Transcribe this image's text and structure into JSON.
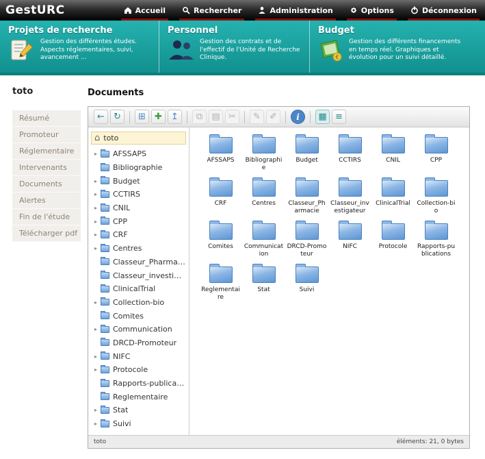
{
  "app": {
    "logo": "GestURC"
  },
  "nav": {
    "items": [
      {
        "icon": "home",
        "label": "Accueil"
      },
      {
        "icon": "search",
        "label": "Rechercher"
      },
      {
        "icon": "user",
        "label": "Administration"
      },
      {
        "icon": "gear",
        "label": "Options"
      },
      {
        "icon": "power",
        "label": "Déconnexion"
      }
    ]
  },
  "banner": {
    "sections": [
      {
        "icon": "projects",
        "title": "Projets de recherche",
        "desc": "Gestion des différentes études. Aspects réglementaires, suivi, avancement ..."
      },
      {
        "icon": "personnel",
        "title": "Personnel",
        "desc": "Gestion des contrats et de l'effectif de l'Unité de Recherche Clinique."
      },
      {
        "icon": "budget",
        "title": "Budget",
        "desc": "Gestion des différents financements en temps réel. Graphiques et évolution pour un suivi détaillé."
      }
    ]
  },
  "sidebar": {
    "title": "toto",
    "items": [
      "Résumé",
      "Promoteur",
      "Réglementaire",
      "Intervenants",
      "Documents",
      "Alertes",
      "Fin de l'étude",
      "Télécharger pdf"
    ]
  },
  "main": {
    "title": "Documents"
  },
  "fm": {
    "toolbar": [
      {
        "name": "back",
        "enabled": true
      },
      {
        "name": "reload",
        "enabled": true
      },
      {
        "name": "sep"
      },
      {
        "name": "new-folder",
        "enabled": true
      },
      {
        "name": "new-file",
        "enabled": true
      },
      {
        "name": "upload",
        "enabled": true
      },
      {
        "name": "sep"
      },
      {
        "name": "copy",
        "enabled": false
      },
      {
        "name": "paste",
        "enabled": false
      },
      {
        "name": "cut",
        "enabled": false
      },
      {
        "name": "sep"
      },
      {
        "name": "rename",
        "enabled": false
      },
      {
        "name": "edit",
        "enabled": false
      },
      {
        "name": "sep"
      },
      {
        "name": "info",
        "enabled": true
      },
      {
        "name": "sep"
      },
      {
        "name": "view-icons",
        "enabled": true,
        "active": true
      },
      {
        "name": "view-list",
        "enabled": true
      }
    ],
    "tree": {
      "root": "toto",
      "items": [
        {
          "name": "AFSSAPS",
          "expandable": true
        },
        {
          "name": "Bibliographie",
          "expandable": false
        },
        {
          "name": "Budget",
          "expandable": true
        },
        {
          "name": "CCTIRS",
          "expandable": true
        },
        {
          "name": "CNIL",
          "expandable": true
        },
        {
          "name": "CPP",
          "expandable": true
        },
        {
          "name": "CRF",
          "expandable": true
        },
        {
          "name": "Centres",
          "expandable": true
        },
        {
          "name": "Classeur_Pharmacie",
          "expandable": false
        },
        {
          "name": "Classeur_investigateur",
          "expandable": false
        },
        {
          "name": "ClinicalTrial",
          "expandable": false
        },
        {
          "name": "Collection-bio",
          "expandable": true
        },
        {
          "name": "Comites",
          "expandable": false
        },
        {
          "name": "Communication",
          "expandable": true
        },
        {
          "name": "DRCD-Promoteur",
          "expandable": false
        },
        {
          "name": "NIFC",
          "expandable": true
        },
        {
          "name": "Protocole",
          "expandable": true
        },
        {
          "name": "Rapports-publications",
          "expandable": false
        },
        {
          "name": "Reglementaire",
          "expandable": false
        },
        {
          "name": "Stat",
          "expandable": true
        },
        {
          "name": "Suivi",
          "expandable": true
        }
      ]
    },
    "grid": [
      "AFSSAPS",
      "Bibliographie",
      "Budget",
      "CCTIRS",
      "CNIL",
      "CPP",
      "CRF",
      "Centres",
      "Classeur_Pharmacie",
      "Classeur_investigateur",
      "ClinicalTrial",
      "Collection-bio",
      "Comites",
      "Communication",
      "DRCD-Promoteur",
      "NIFC",
      "Protocole",
      "Rapports-publications",
      "Reglementaire",
      "Stat",
      "Suivi"
    ],
    "status": {
      "left": "toto",
      "right": "éléments: 21, 0 bytes"
    }
  }
}
